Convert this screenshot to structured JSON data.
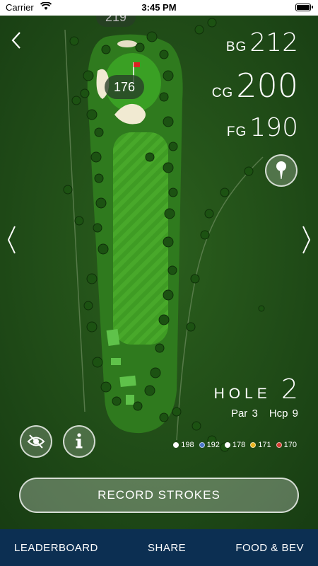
{
  "status": {
    "carrier": "Carrier",
    "time": "3:45 PM"
  },
  "map": {
    "top_distance": "219",
    "target_distance": "176"
  },
  "distances": {
    "back": {
      "label": "BG",
      "value": "212"
    },
    "center": {
      "label": "CG",
      "value": "200"
    },
    "front": {
      "label": "FG",
      "value": "190"
    }
  },
  "hole": {
    "label": "HOLE",
    "number": "2",
    "par": "Par 3",
    "handicap": "Hcp 9"
  },
  "tees": [
    {
      "yards": "198",
      "color": "#ffffff"
    },
    {
      "yards": "192",
      "color": "#4a76c9"
    },
    {
      "yards": "178",
      "color": "#ffffff"
    },
    {
      "yards": "171",
      "color": "#e8b21a"
    },
    {
      "yards": "170",
      "color": "#d23a2e"
    }
  ],
  "record_button": "RECORD STROKES",
  "tabs": {
    "leaderboard": "LEADERBOARD",
    "share": "SHARE",
    "food": "FOOD & BEV"
  },
  "colors": {
    "tabbar": "#0c2f52",
    "rough": "#1f4a18",
    "fairway": "#3f9c24"
  }
}
